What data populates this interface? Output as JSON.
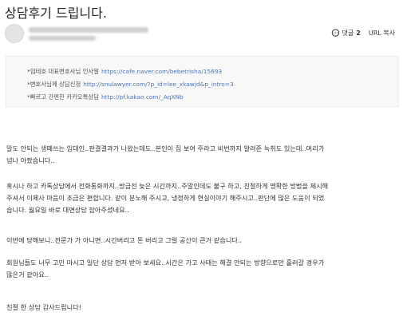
{
  "post": {
    "title": "상담후기 드립니다.",
    "comment_label": "댓글",
    "comment_count": "2",
    "url_copy_label": "URL 복사"
  },
  "links": [
    {
      "label": "*임테호 대표변호사님 인사말",
      "url": "https://cafe.naver.com/bebetrisha/15693"
    },
    {
      "label": "*변호사님께 상담신청",
      "url": "http://snulawyer.com/?p_id=lee_xkawjd&p_intro=3"
    },
    {
      "label": "*빠르고 간편한 카카오톡상담",
      "url": "http://pf.kakao.com/_AqXNb"
    }
  ],
  "body": {
    "p1": [
      "말도 안되는 생떼쓰는 임대인..판결결과가 나왔는데도..본인이 집 보여 주라고 비번까지 알려준 녹취도 있는데..머리가",
      "넘나 아팠습니다.."
    ],
    "p2": [
      "혹시나 하고 카톡상담에서 전화통화까지..방금전 늦은 시간까지..주말인데도 불구 하고, 친절하게 명확한 방법을 제시해",
      "주셔서 이제사 마음이 조금은 편합니다.  같이 분노해 주시고, 냉정하게 현실이야기 해주시고..판단에 많은 도움이 되었",
      "습니다. 월요일 바로 대면상담  잡아주셨네요.."
    ],
    "p3": [
      "이번에 당해보니..전문가 가 아니면..시간버리고 돈 버리고 그럴 공산이 큰거 같습니다.."
    ],
    "p4": [
      "회원님들도 너무 고민 마시고 일단 상담 먼저 받아 보세요..시간은 가고 사태는 해결 안되는 방향으로만 흘러갈 경우가",
      "많은거 같아요.."
    ],
    "p5": [
      "친절 한 상담 감사드립니다!"
    ]
  },
  "icons": {
    "comment": "chat-bubble-icon"
  },
  "colors": {
    "link": "#4a76b8",
    "link_box_bg": "#f8f8f8"
  }
}
